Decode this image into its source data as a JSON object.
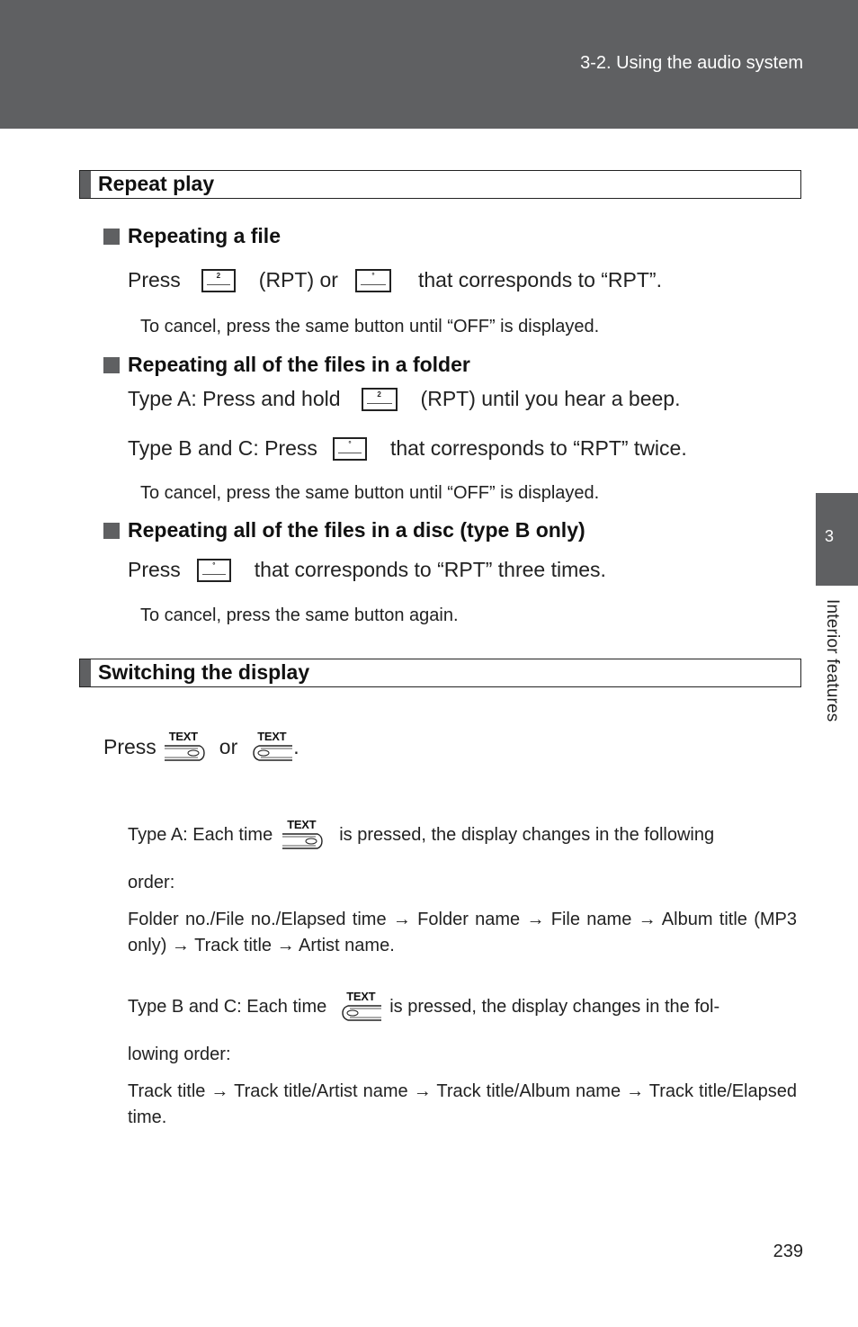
{
  "header": {
    "section_title": "3-2. Using the audio system"
  },
  "side_tab": {
    "chapter_number": "3",
    "chapter_label": "Interior features"
  },
  "sections": [
    {
      "title": "Repeat play",
      "subsections": [
        {
          "heading": "Repeating a file",
          "instruction": {
            "press": "Press",
            "button1_label": "2",
            "between": "(RPT) or",
            "button2_label": "°",
            "after": "that corresponds to “RPT”."
          },
          "note": "To cancel, press the same button until “OFF” is displayed."
        },
        {
          "heading": "Repeating all of the files in a folder",
          "type_a": {
            "before": "Type A: Press and hold",
            "button_label": "2",
            "after": "(RPT) until you hear a beep."
          },
          "type_bc": {
            "before": "Type B and C: Press",
            "button_label": "°",
            "after": "that corresponds to “RPT” twice."
          },
          "note": "To cancel, press the same button until “OFF” is displayed."
        },
        {
          "heading": "Repeating all of the files in a disc (type B only)",
          "instruction": {
            "press": "Press",
            "button_label": "°",
            "after": "that corresponds to “RPT” three times."
          },
          "note": "To cancel, press the same button again."
        }
      ]
    },
    {
      "title": "Switching the display",
      "press_line": {
        "press": "Press",
        "button_caption": "TEXT",
        "or": "or",
        "period": "."
      },
      "type_a": {
        "before": "Type A: Each time",
        "button_caption": "TEXT",
        "after": "is pressed, the display changes in the following",
        "continuation": "order:",
        "sequence": "Folder no./File no./Elapsed time → Folder name → File name → Album title (MP3 only) → Track title → Artist name."
      },
      "type_bc": {
        "before": "Type B and C: Each time",
        "button_caption": "TEXT",
        "after": "is pressed, the display changes in the fol-",
        "continuation": "lowing order:",
        "sequence": "Track title → Track title/Artist name → Track title/Album name → Track title/Elapsed time."
      }
    }
  ],
  "footer": {
    "page_number": "239"
  }
}
